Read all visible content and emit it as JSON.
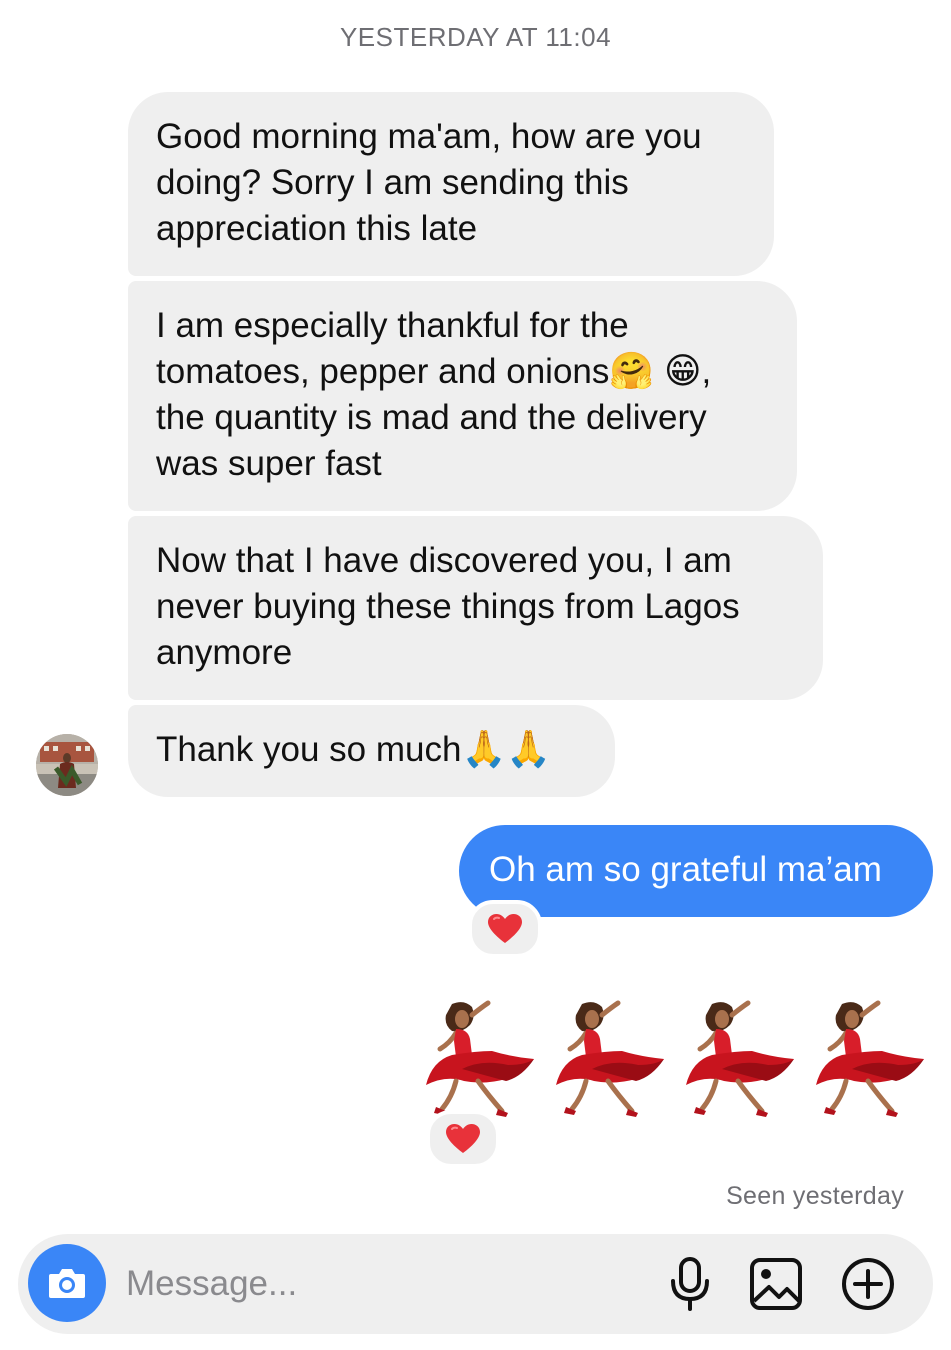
{
  "thread": {
    "timestamp": "YESTERDAY AT 11:04",
    "incoming": [
      {
        "text": "Good morning ma'am, how are you doing? Sorry I am sending this appreciation this late"
      },
      {
        "text_before": "I am especially thankful for the tomatoes, pepper and onions",
        "emoji_1": "🤗",
        "emoji_2": "😁",
        "text_after": ", the quantity is mad and the delivery was super fast"
      },
      {
        "text": "Now that I have discovered you, I am never buying these things from Lagos anymore"
      },
      {
        "text": "Thank you so much",
        "emoji": "🙏🙏"
      }
    ],
    "outgoing": {
      "text": "Oh am so grateful ma’am",
      "reaction": "❤️"
    },
    "emoji_message": {
      "emoji_name": "woman-dancing-medium-skin-tone",
      "count": 4,
      "reaction": "❤️"
    },
    "seen": "Seen yesterday"
  },
  "composer": {
    "placeholder": "Message...",
    "icons": [
      "camera-icon",
      "microphone-icon",
      "gallery-icon",
      "plus-circle-icon"
    ]
  },
  "colors": {
    "accent": "#3a86f7",
    "incoming_bubble": "#efefef",
    "heart": "#e8323a"
  }
}
